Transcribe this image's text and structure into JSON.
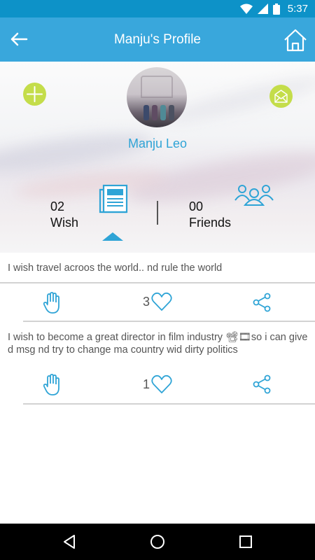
{
  "status_bar": {
    "time": "5:37"
  },
  "app_bar": {
    "title": "Manju's Profile"
  },
  "profile": {
    "name": "Manju Leo"
  },
  "stats": {
    "wish": {
      "count": "02",
      "label": "Wish"
    },
    "friends": {
      "count": "00",
      "label": "Friends"
    }
  },
  "posts": [
    {
      "text": "I wish travel acroos the world.. nd rule the world",
      "likes": "3"
    },
    {
      "text": "I wish to become a great director in film industry 📽🎞so i can give d msg nd try to change ma country wid dirty politics",
      "likes": "1"
    }
  ],
  "colors": {
    "status_bar": "#0d92c8",
    "app_bar": "#39a7dc",
    "accent": "#2fa4d6",
    "fab": "#c4dd4a"
  },
  "icons": [
    "back-arrow-icon",
    "home-icon",
    "add-icon",
    "mail-icon",
    "wish-list-icon",
    "friends-icon",
    "hand-icon",
    "heart-icon",
    "share-icon",
    "nav-back-icon",
    "nav-home-icon",
    "nav-recents-icon"
  ]
}
